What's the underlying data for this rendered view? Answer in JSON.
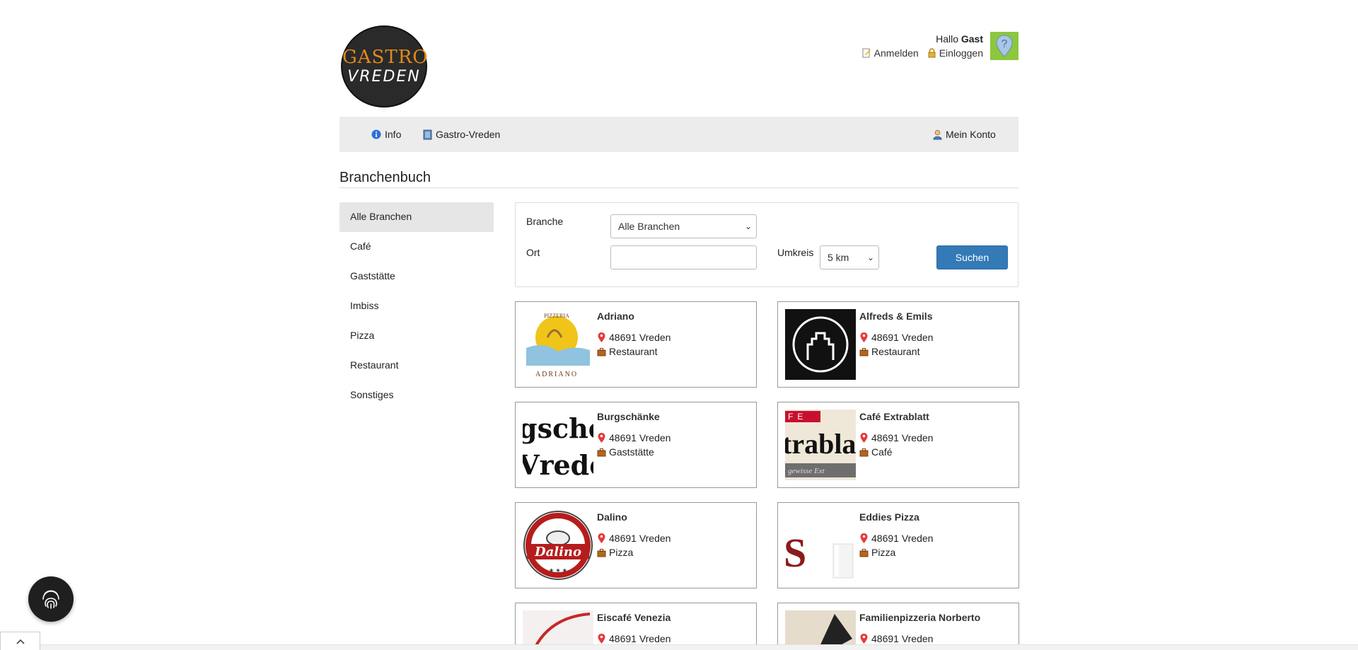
{
  "header": {
    "logo_line1": "GASTRO",
    "logo_line2": "VREDEN",
    "greeting_prefix": "Hallo",
    "greeting_user": "Gast",
    "register_label": "Anmelden",
    "login_label": "Einloggen"
  },
  "nav": {
    "info_label": "Info",
    "site_label": "Gastro-Vreden",
    "account_label": "Mein Konto"
  },
  "page": {
    "title": "Branchenbuch"
  },
  "sidebar": {
    "items": [
      {
        "label": "Alle Branchen",
        "active": true
      },
      {
        "label": "Café"
      },
      {
        "label": "Gaststätte"
      },
      {
        "label": "Imbiss"
      },
      {
        "label": "Pizza"
      },
      {
        "label": "Restaurant"
      },
      {
        "label": "Sonstiges"
      }
    ]
  },
  "search": {
    "branche_label": "Branche",
    "branche_value": "Alle Branchen",
    "ort_label": "Ort",
    "ort_value": "",
    "umkreis_label": "Umkreis",
    "umkreis_value": "5 km",
    "submit_label": "Suchen"
  },
  "listings": [
    {
      "name": "Adriano",
      "city": "48691 Vreden",
      "category": "Restaurant",
      "logo_text": "PIZZERIA ADRIANO"
    },
    {
      "name": "Alfreds & Emils",
      "city": "48691 Vreden",
      "category": "Restaurant"
    },
    {
      "name": "Burgschänke",
      "city": "48691 Vreden",
      "category": "Gaststätte",
      "logo_text": "gsche Vrede"
    },
    {
      "name": "Café Extrablatt",
      "city": "48691 Vreden",
      "category": "Café",
      "logo_text": "traibla"
    },
    {
      "name": "Dalino",
      "city": "48691 Vreden",
      "category": "Pizza",
      "logo_text": "Dalino"
    },
    {
      "name": "Eddies Pizza",
      "city": "48691 Vreden",
      "category": "Pizza"
    },
    {
      "name": "Eiscafé Venezia",
      "city": "48691 Vreden",
      "category": ""
    },
    {
      "name": "Familienpizzeria Norberto",
      "city": "48691 Vreden",
      "category": ""
    }
  ],
  "colors": {
    "nav_bg": "#ececec",
    "primary": "#337ab7",
    "help_badge": "#8dc63f"
  }
}
